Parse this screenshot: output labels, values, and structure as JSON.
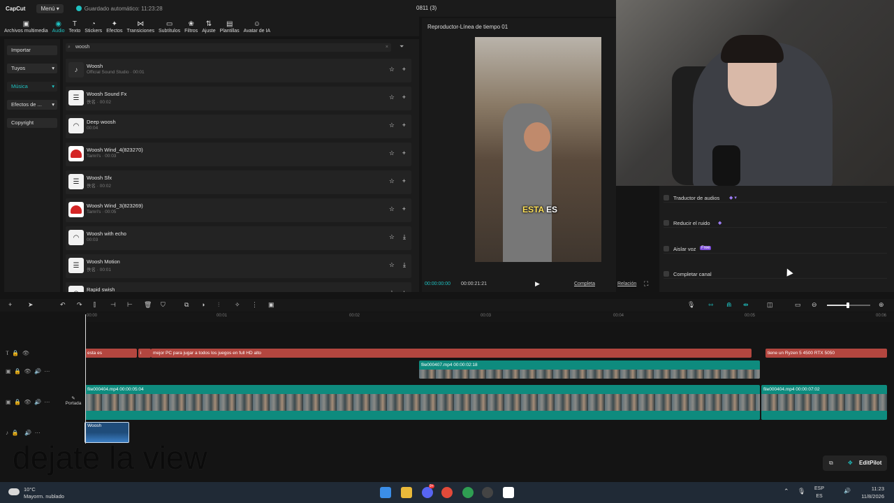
{
  "app": {
    "logo": "CapCut",
    "menu_label": "Menú",
    "autosave": "Guardado automático: 11:23:28",
    "project_title": "0811 (3)"
  },
  "toolbar": {
    "tools": [
      {
        "label": "Archivos multimedia",
        "icon": "media-icon"
      },
      {
        "label": "Audio",
        "icon": "audio-icon",
        "active": true
      },
      {
        "label": "Texto",
        "icon": "text-icon"
      },
      {
        "label": "Stickers",
        "icon": "sticker-icon"
      },
      {
        "label": "Efectos",
        "icon": "effects-icon"
      },
      {
        "label": "Transiciones",
        "icon": "transitions-icon"
      },
      {
        "label": "Subtítulos",
        "icon": "subtitles-icon"
      },
      {
        "label": "Filtros",
        "icon": "filters-icon"
      },
      {
        "label": "Ajuste",
        "icon": "adjust-icon"
      },
      {
        "label": "Plantillas",
        "icon": "templates-icon"
      },
      {
        "label": "Avatar de IA",
        "icon": "ai-avatar-icon"
      }
    ]
  },
  "sidebar": {
    "import_label": "Importar",
    "items": [
      {
        "label": "Tuyos",
        "chevron": true
      },
      {
        "label": "Música",
        "chevron": true,
        "selected": true
      },
      {
        "label": "Efectos de ...",
        "chevron": true
      },
      {
        "label": "Copyright",
        "chevron": false
      }
    ]
  },
  "audio_panel": {
    "search_value": "woosh",
    "tracks": [
      {
        "name": "Woosh",
        "meta": "Official Sound Studio · 00:01",
        "thumb": "dark",
        "action": "add"
      },
      {
        "name": "Woosh Sound Fx",
        "meta": "佚名 · 00:02",
        "thumb": "doc",
        "action": "add"
      },
      {
        "name": "Deep woosh",
        "meta": "00:04",
        "thumb": "headphone",
        "action": "add"
      },
      {
        "name": "Woosh Wind_4(823270)",
        "meta": "Tamri's · 00:03",
        "thumb": "red",
        "action": "add"
      },
      {
        "name": "Woosh Sfx",
        "meta": "佚名 · 00:02",
        "thumb": "doc",
        "action": "add"
      },
      {
        "name": "Woosh Wind_3(823269)",
        "meta": "Tamri's · 00:05",
        "thumb": "red",
        "action": "add"
      },
      {
        "name": "Woosh with echo",
        "meta": "00:03",
        "thumb": "headphone",
        "action": "download"
      },
      {
        "name": "Woosh Motion",
        "meta": "佚名 · 00:01",
        "thumb": "doc",
        "action": "download"
      },
      {
        "name": "Rapid swish",
        "meta": "",
        "thumb": "headphone",
        "action": "add"
      }
    ]
  },
  "player": {
    "title": "Reproductor-Línea de tiempo 01",
    "caption_part1": "ESTA",
    "caption_part2": "ES",
    "time_current": "00:00:00:00",
    "time_total": "00:00:21:21",
    "full_label": "Completa",
    "ratio_label": "Relación"
  },
  "properties": {
    "items": [
      {
        "label": "Traductor de audios",
        "extra": "gem"
      },
      {
        "label": "Reducir el ruido",
        "extra": "gem"
      },
      {
        "label": "Aislar voz",
        "extra": "Free"
      },
      {
        "label": "Completar canal",
        "extra": ""
      }
    ]
  },
  "timeline": {
    "ruler_ticks": [
      "00:00",
      "00:01",
      "00:02",
      "00:03",
      "00:04",
      "00:05",
      "00:06"
    ],
    "text_clips": [
      {
        "label": "esta es"
      },
      {
        "label": "i"
      },
      {
        "label": "mejor PC para jugar a todos los juegos en full HD alto"
      },
      {
        "label": "tiene un Ryzen 5 4500 RTX 5050"
      }
    ],
    "overlay_clip": {
      "label": "file000407.mp4   00:00:02:18"
    },
    "main_clips": [
      {
        "label": "file000404.mp4   00:00:05:04"
      },
      {
        "label": "file000404.mp4   00:00:07:02"
      }
    ],
    "audio_clip": {
      "label": "Woosh"
    },
    "cover_label": "Portada"
  },
  "overlay_text": "dejate la view",
  "editpilot_label": "EditPilot",
  "taskbar": {
    "temp": "10°C",
    "weather": "Mayorm. nublado",
    "lang_top": "ESP",
    "lang_bottom": "ES",
    "time": "11:23",
    "date": "11/8/2026",
    "discord_badge": "9+"
  }
}
